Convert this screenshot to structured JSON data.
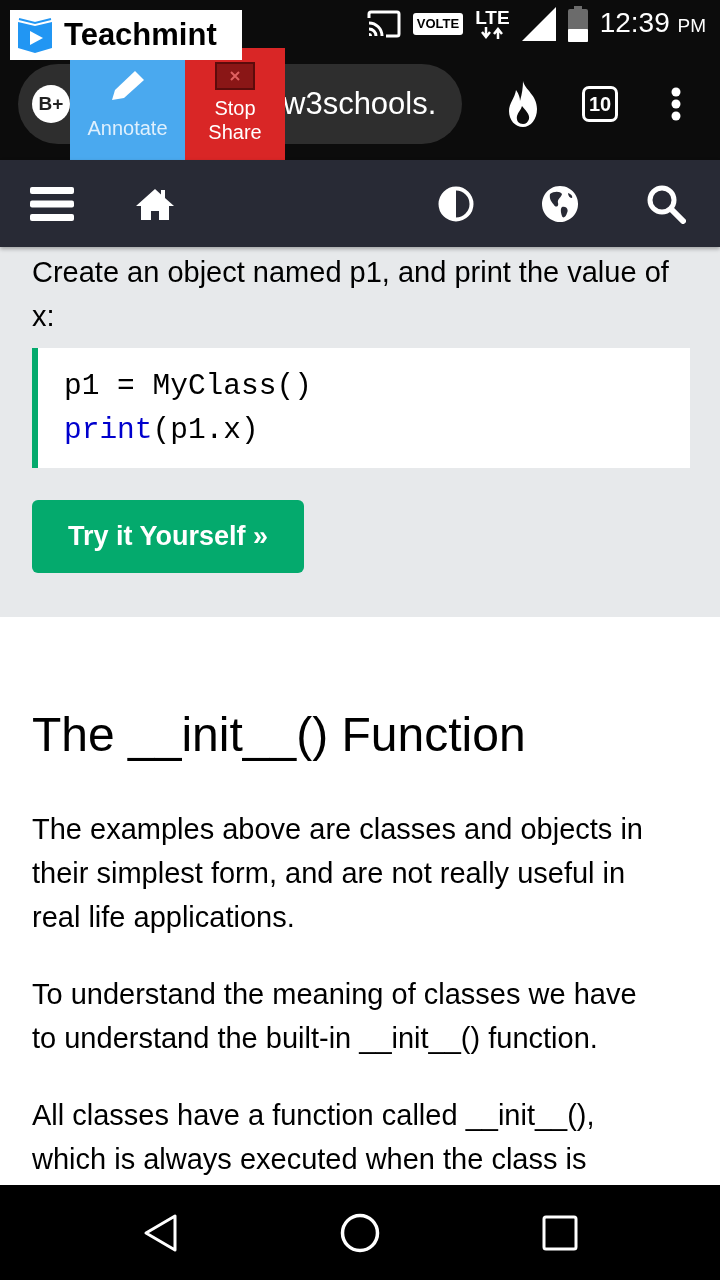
{
  "brand_overlay": {
    "name": "Teachmint"
  },
  "share_controls": [
    {
      "kind": "annotate",
      "label": "Annotate"
    },
    {
      "kind": "stop",
      "label": "Stop Share"
    }
  ],
  "status_bar": {
    "volte": "VOLTE",
    "network": "LTE",
    "time": "12:39",
    "meridiem": "PM"
  },
  "browser_toolbar": {
    "avatar": "B+",
    "url": "w3schools.",
    "tab_count": "10"
  },
  "site_nav": {
    "left": [
      {
        "kind": "menu"
      },
      {
        "kind": "home"
      }
    ],
    "right": [
      {
        "kind": "contrast"
      },
      {
        "kind": "globe"
      },
      {
        "kind": "search"
      }
    ]
  },
  "example": {
    "intro": "Create an object named p1, and print the value of x:",
    "code_lines": [
      [
        {
          "kind": "plain",
          "text": "p1 = MyClass()"
        }
      ],
      [
        {
          "kind": "keyword",
          "text": "print"
        },
        {
          "kind": "plain",
          "text": "(p1.x)"
        }
      ]
    ],
    "button": "Try it Yourself »"
  },
  "section": {
    "heading": "The __init__() Function",
    "paragraphs": [
      "The examples above are classes and objects in their simplest form, and are not really useful in real life applications.",
      "To understand the meaning of classes we have to understand the built-in __init__() function.",
      "All classes have a function called __init__(), which is always executed when the class is"
    ]
  },
  "system_nav": [
    {
      "kind": "back"
    },
    {
      "kind": "home"
    },
    {
      "kind": "recents"
    }
  ]
}
